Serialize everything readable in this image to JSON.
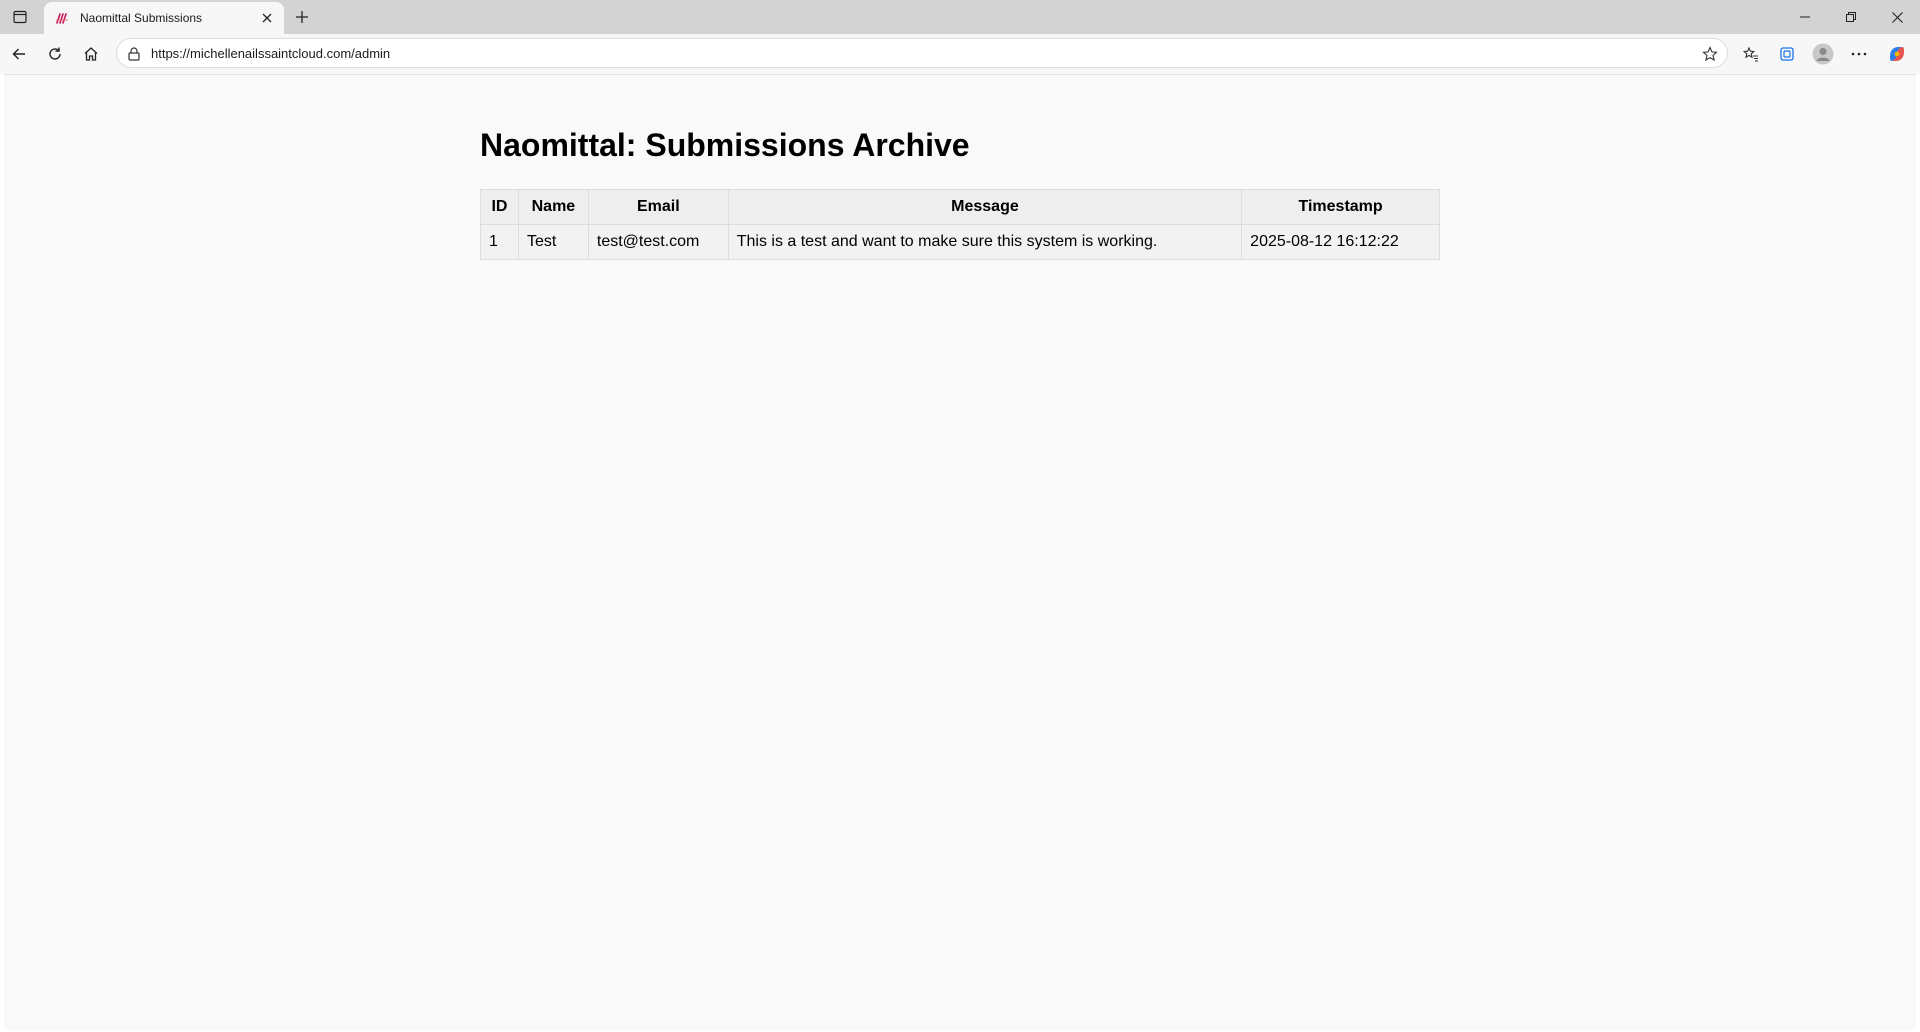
{
  "browser": {
    "tab": {
      "title": "Naomittal Submissions"
    },
    "address": {
      "url": "https://michellenailssaintcloud.com/admin"
    },
    "icons": {
      "tab_actions": "tab-actions-icon",
      "favicon": "nail-polish-favicon",
      "close_tab": "close-icon",
      "new_tab": "plus-icon",
      "back": "back-arrow-icon",
      "refresh": "refresh-icon",
      "home": "home-icon",
      "lock": "lock-icon",
      "favorite": "star-icon",
      "favorites": "favorites-icon",
      "collections": "collections-icon",
      "profile": "profile-avatar-icon",
      "more": "more-icon",
      "copilot": "copilot-icon",
      "minimize": "minimize-icon",
      "restore": "restore-icon",
      "close_window": "close-icon"
    }
  },
  "page": {
    "title": "Naomittal: Submissions Archive",
    "table": {
      "headers": [
        "ID",
        "Name",
        "Email",
        "Message",
        "Timestamp"
      ],
      "rows": [
        [
          "1",
          "Test",
          "test@test.com",
          "This is a test and want to make sure this system is working.",
          "2025-08-12 16:12:22"
        ]
      ]
    }
  },
  "colors": {
    "titlebar": "#d3d3d3",
    "toolbar": "#f7f7f7",
    "page_background": "#f9f9f9",
    "table_header": "#eeeeee",
    "table_cell": "#f2f2f2",
    "table_border": "#dddddd"
  }
}
